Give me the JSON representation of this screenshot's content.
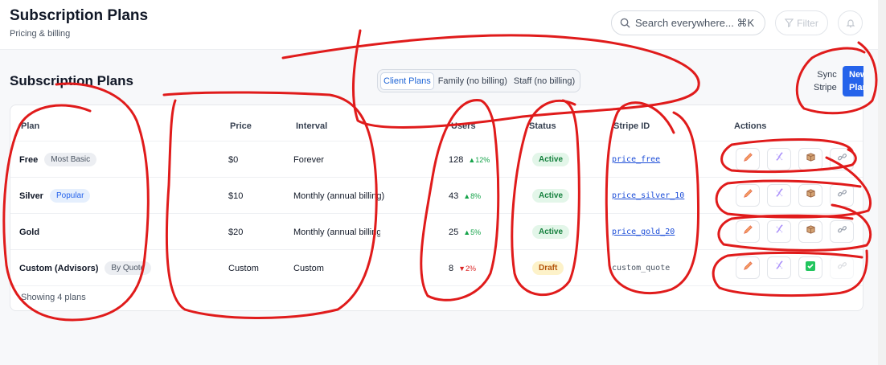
{
  "header": {
    "title": "Subscription Plans",
    "subtitle": "Pricing & billing",
    "search_placeholder": "Search everywhere... ⌘K",
    "filter_label": "Filter"
  },
  "section": {
    "title": "Subscription Plans",
    "tabs": [
      {
        "label": "Client Plans",
        "active": true
      },
      {
        "label": "Family (no billing)",
        "active": false
      },
      {
        "label": "Staff (no billing)",
        "active": false
      }
    ],
    "sync_label_line1": "Sync",
    "sync_label_line2": "Stripe",
    "new_button_line1": "New",
    "new_button_line2": "Plan"
  },
  "table": {
    "columns": [
      "Plan",
      "Price",
      "Interval",
      "Users",
      "Status",
      "Stripe ID",
      "Actions"
    ],
    "rows": [
      {
        "plan": "Free",
        "tag": "Most Basic",
        "tag_style": "gray",
        "price": "$0",
        "interval": "Forever",
        "users": "128",
        "trend": "▲12%",
        "trend_dir": "up",
        "status": "Active",
        "stripe_id": "price_free",
        "stripe_linked": true,
        "fourth_action": "link-icon",
        "fourth_disabled": false
      },
      {
        "plan": "Silver",
        "tag": "Popular",
        "tag_style": "blue",
        "price": "$10",
        "interval": "Monthly (annual billing)",
        "users": "43",
        "trend": "▲8%",
        "trend_dir": "up",
        "status": "Active",
        "stripe_id": "price_silver_10",
        "stripe_linked": true,
        "fourth_action": "link-icon",
        "fourth_disabled": false
      },
      {
        "plan": "Gold",
        "tag": "",
        "tag_style": "gray",
        "price": "$20",
        "interval": "Monthly (annual billing)",
        "users": "25",
        "trend": "▲5%",
        "trend_dir": "up",
        "status": "Active",
        "stripe_id": "price_gold_20",
        "stripe_linked": true,
        "fourth_action": "link-icon",
        "fourth_disabled": false
      },
      {
        "plan": "Custom (Advisors)",
        "tag": "By Quote",
        "tag_style": "gray",
        "price": "Custom",
        "interval": "Custom",
        "users": "8",
        "trend": "▼2%",
        "trend_dir": "down",
        "status": "Draft",
        "stripe_id": "custom_quote",
        "stripe_linked": false,
        "fourth_action": "link-icon",
        "fourth_disabled": true
      }
    ],
    "footer": "Showing 4 plans"
  },
  "colors": {
    "accent": "#2563eb",
    "annotation": "#e01b1b",
    "active_bg": "#e3f6e9",
    "draft_bg": "#fdf2c9"
  }
}
